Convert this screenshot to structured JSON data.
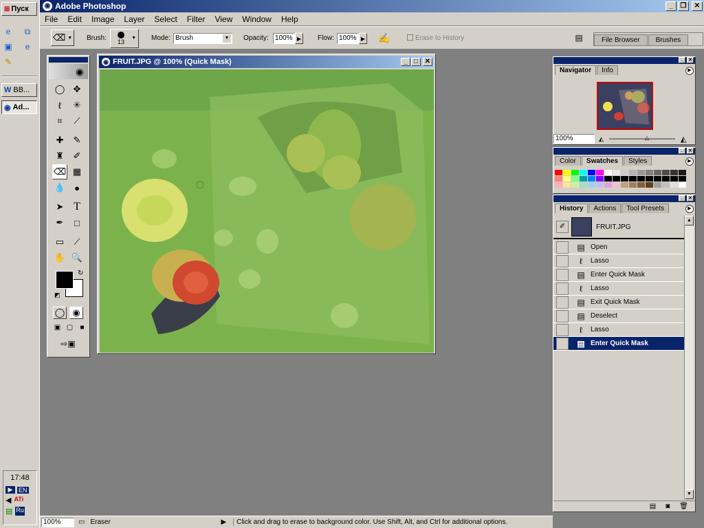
{
  "taskbar": {
    "start_label": "Пуск",
    "tasks": [
      {
        "label": "BB..."
      },
      {
        "label": "Ad..."
      }
    ],
    "clock": "17:48",
    "lang": "EN"
  },
  "app": {
    "title": "Adobe Photoshop",
    "menu": [
      "File",
      "Edit",
      "Image",
      "Layer",
      "Select",
      "Filter",
      "View",
      "Window",
      "Help"
    ]
  },
  "options": {
    "brush_label": "Brush:",
    "brush_size": "13",
    "mode_label": "Mode:",
    "mode_value": "Brush",
    "opacity_label": "Opacity:",
    "opacity_value": "100%",
    "flow_label": "Flow:",
    "flow_value": "100%",
    "erase_history_label": "Erase to History",
    "file_browser_tab": "File Browser",
    "brushes_tab": "Brushes"
  },
  "document": {
    "title": "FRUIT.JPG @ 100% (Quick Mask)"
  },
  "navigator": {
    "tabs": [
      "Navigator",
      "Info"
    ],
    "zoom": "100%"
  },
  "swatches": {
    "tabs": [
      "Color",
      "Swatches",
      "Styles"
    ],
    "colors": [
      "#ff0000",
      "#ffff00",
      "#00ff00",
      "#00ffff",
      "#0000ff",
      "#ff00ff",
      "#ffffff",
      "#e6e6e6",
      "#cccccc",
      "#b3b3b3",
      "#999999",
      "#808080",
      "#666666",
      "#4d4d4d",
      "#333333",
      "#1a1a1a",
      "#ff8080",
      "#ffff80",
      "#80ff80",
      "#00a0a0",
      "#0080ff",
      "#8000ff",
      "#000000",
      "#000000",
      "#000000",
      "#000000",
      "#000000",
      "#000000",
      "#000000",
      "#000000",
      "#000000",
      "#000000",
      "#ffb0b0",
      "#ffe0a0",
      "#d0f0a0",
      "#a0e0c0",
      "#a0d0f0",
      "#c0c0f0",
      "#e0a0e0",
      "#f0c0d0",
      "#c0a080",
      "#a08060",
      "#806040",
      "#604020",
      "#a0a0a0",
      "#c0c0c0",
      "#e0e0e0",
      "#ffffff"
    ]
  },
  "history": {
    "tabs": [
      "History",
      "Actions",
      "Tool Presets"
    ],
    "snapshot": "FRUIT.JPG",
    "items": [
      "Open",
      "Lasso",
      "Enter Quick Mask",
      "Lasso",
      "Exit Quick Mask",
      "Deselect",
      "Lasso",
      "Enter Quick Mask"
    ]
  },
  "status": {
    "zoom": "100%",
    "tool": "Eraser",
    "message": "Click and drag to erase to background color.  Use Shift, Alt, and Ctrl for additional options."
  }
}
